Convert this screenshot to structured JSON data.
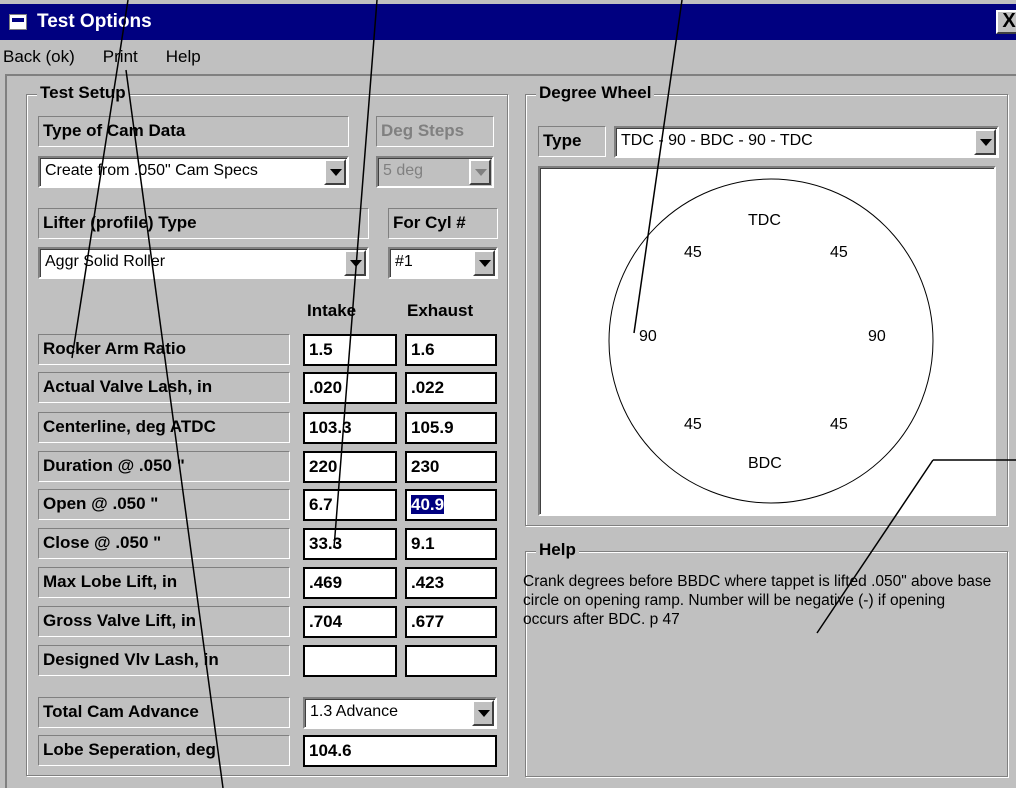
{
  "window": {
    "title": "Test Options",
    "close_glyph": "X"
  },
  "menu": {
    "back": "Back (ok)",
    "print": "Print",
    "help": "Help"
  },
  "test_setup": {
    "legend": "Test Setup",
    "cam_data_label": "Type of Cam Data",
    "cam_data_value": "Create from .050\" Cam Specs",
    "deg_steps_label": "Deg Steps",
    "deg_steps_value": "5 deg",
    "lifter_label": "Lifter (profile) Type",
    "lifter_value": "Aggr Solid Roller",
    "cyl_label": "For Cyl #",
    "cyl_value": "#1",
    "col_intake": "Intake",
    "col_exhaust": "Exhaust",
    "rows": [
      {
        "label": "Rocker Arm Ratio",
        "intake": "1.5",
        "exhaust": "1.6"
      },
      {
        "label": "Actual Valve Lash, in",
        "intake": ".020",
        "exhaust": ".022"
      },
      {
        "label": "Centerline, deg ATDC",
        "intake": "103.3",
        "exhaust": "105.9"
      },
      {
        "label": "Duration @ .050 \"",
        "intake": "220",
        "exhaust": "230"
      },
      {
        "label": "Open @ .050 \"",
        "intake": "6.7",
        "exhaust": "40.9"
      },
      {
        "label": "Close @ .050 \"",
        "intake": "33.3",
        "exhaust": "9.1"
      },
      {
        "label": "Max Lobe Lift, in",
        "intake": ".469",
        "exhaust": ".423"
      },
      {
        "label": "Gross Valve Lift, in",
        "intake": ".704",
        "exhaust": ".677"
      },
      {
        "label": "Designed Vlv Lash, in",
        "intake": "",
        "exhaust": ""
      }
    ],
    "advance_label": "Total Cam Advance",
    "advance_value": "1.3 Advance",
    "lobe_sep_label": "Lobe Seperation, deg",
    "lobe_sep_value": "104.6"
  },
  "degree_wheel": {
    "legend": "Degree Wheel",
    "type_label": "Type",
    "type_value": "TDC - 90 - BDC - 90 - TDC",
    "labels": {
      "top": "TDC",
      "bottom": "BDC",
      "upper_left": "45",
      "upper_right": "45",
      "left": "90",
      "right": "90",
      "lower_left": "45",
      "lower_right": "45"
    }
  },
  "help": {
    "legend": "Help",
    "text": "Crank degrees before BBDC where tappet is lifted .050\" above base circle on opening ramp.  Number will be negative (-) if opening occurs after BDC.  p 47"
  }
}
